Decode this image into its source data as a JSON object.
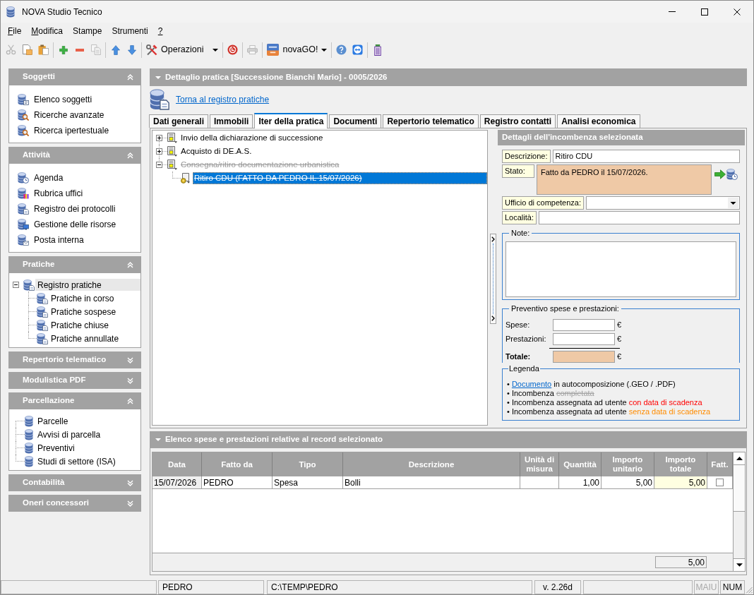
{
  "window": {
    "title": "NOVA Studio Tecnico"
  },
  "menu": [
    {
      "label": "File",
      "mnemonic": true
    },
    {
      "label": "Modifica",
      "mnemonic": true
    },
    {
      "label": "Stampe",
      "mnemonic": false
    },
    {
      "label": "Strumenti",
      "mnemonic": false
    },
    {
      "label": "?",
      "mnemonic": true
    }
  ],
  "toolbar": [
    {
      "kind": "button",
      "disabled": true
    },
    {
      "kind": "button",
      "disabled": false
    },
    {
      "kind": "button",
      "disabled": false
    },
    {
      "kind": "separator"
    },
    {
      "kind": "button",
      "disabled": false
    },
    {
      "kind": "button",
      "disabled": false
    },
    {
      "kind": "button",
      "disabled": true
    },
    {
      "kind": "separator"
    },
    {
      "kind": "button",
      "disabled": false
    },
    {
      "kind": "button",
      "disabled": false
    },
    {
      "kind": "separator"
    },
    {
      "kind": "menu_button",
      "label": "Operazioni"
    },
    {
      "kind": "separator"
    },
    {
      "kind": "button",
      "disabled": false
    },
    {
      "kind": "separator"
    },
    {
      "kind": "button",
      "disabled": true
    },
    {
      "kind": "separator"
    },
    {
      "kind": "menu_button",
      "label": "novaGO!"
    },
    {
      "kind": "separator"
    },
    {
      "kind": "button",
      "disabled": false
    },
    {
      "kind": "button",
      "disabled": false
    },
    {
      "kind": "separator"
    },
    {
      "kind": "button",
      "disabled": false
    }
  ],
  "sidebar": {
    "panels": [
      {
        "title": "Soggetti",
        "expanded": true,
        "kind": "list",
        "items": [
          {
            "label": "Elenco soggetti",
            "selected": false
          },
          {
            "label": "Ricerche avanzate",
            "selected": false
          },
          {
            "label": "Ricerca ipertestuale",
            "selected": false
          }
        ]
      },
      {
        "title": "Attività",
        "expanded": true,
        "kind": "list",
        "items": [
          {
            "label": "Agenda",
            "selected": false
          },
          {
            "label": "Rubrica uffici",
            "selected": false
          },
          {
            "label": "Registro dei protocolli",
            "selected": false
          },
          {
            "label": "Gestione delle risorse",
            "selected": false
          },
          {
            "label": "Posta interna",
            "selected": false
          }
        ]
      },
      {
        "title": "Pratiche",
        "expanded": true,
        "kind": "tree",
        "items": [
          {
            "label": "Registro pratiche",
            "selected": true,
            "expanded": true,
            "children": [
              {
                "label": "Pratiche in corso",
                "selected": false
              },
              {
                "label": "Pratiche sospese",
                "selected": false
              },
              {
                "label": "Pratiche chiuse",
                "selected": false
              },
              {
                "label": "Pratiche annullate",
                "selected": false
              }
            ]
          }
        ]
      },
      {
        "title": "Repertorio telematico",
        "expanded": false
      },
      {
        "title": "Modulistica PDF",
        "expanded": false
      },
      {
        "title": "Parcellazione",
        "expanded": true,
        "kind": "tree",
        "items": [
          {
            "label": "Parcelle",
            "selected": false
          },
          {
            "label": "Avvisi di parcella",
            "selected": false
          },
          {
            "label": "Preventivi",
            "selected": false
          },
          {
            "label": "Studi di settore (ISA)",
            "selected": false
          }
        ]
      },
      {
        "title": "Contabilità",
        "expanded": false
      },
      {
        "title": "Oneri concessori",
        "expanded": false
      }
    ]
  },
  "detail": {
    "title": "Dettaglio pratica [Successione Bianchi Mario] - 0005/2026",
    "back_link": "Torna al registro pratiche",
    "tabs": [
      {
        "label": "Dati generali",
        "selected": false
      },
      {
        "label": "Immobili",
        "selected": false
      },
      {
        "label": "Iter della pratica",
        "selected": true
      },
      {
        "label": "Documenti",
        "selected": false
      },
      {
        "label": "Repertorio telematico",
        "selected": false
      },
      {
        "label": "Registro contatti",
        "selected": false
      },
      {
        "label": "Analisi economica",
        "selected": false
      }
    ],
    "tree": [
      {
        "kind": "group",
        "label": "Invio della dichiarazione di successione",
        "expanded": false,
        "completed": false,
        "selected": false
      },
      {
        "kind": "group",
        "label": "Acquisto di DE.A.S.",
        "expanded": false,
        "completed": false,
        "selected": false
      },
      {
        "kind": "group",
        "label": "Consegna/ritiro documentazione urbanistica",
        "expanded": true,
        "completed": true,
        "selected": false,
        "children": [
          {
            "kind": "task",
            "label": "Ritiro CDU (FATTO DA PEDRO IL 15/07/2026)",
            "completed": true,
            "selected": true
          }
        ]
      }
    ],
    "panel": {
      "title": "Dettagli dell'incombenza selezionata",
      "fields": [
        {
          "kind": "text",
          "label": "Descrizione:",
          "value": "Ritiro CDU"
        },
        {
          "kind": "status",
          "label": "Stato:",
          "value": "Fatto da PEDRO il 15/07/2026."
        },
        {
          "kind": "select",
          "label": "Ufficio di competenza:"
        },
        {
          "kind": "text",
          "label": "Località:"
        }
      ],
      "notes": {
        "title": "Note:"
      },
      "estimate": {
        "title": "Preventivo spese e prestazioni:",
        "rows": [
          {
            "kind": "input",
            "label": "Spese:",
            "currency": "€"
          },
          {
            "kind": "input",
            "label": "Prestazioni:",
            "currency": "€"
          },
          {
            "kind": "total",
            "label": "Totale:",
            "currency": "€"
          }
        ]
      },
      "legend": {
        "title": "Legenda",
        "items": [
          {
            "parts": [
              {
                "kind": "plain",
                "text": "• "
              },
              {
                "kind": "link",
                "text": "Documento"
              },
              {
                "kind": "plain",
                "text": " in autocomposizione (.GEO / .PDF)"
              }
            ]
          },
          {
            "parts": [
              {
                "kind": "plain",
                "text": "• Incombenza "
              },
              {
                "kind": "completed",
                "text": "completata"
              }
            ]
          },
          {
            "parts": [
              {
                "kind": "plain",
                "text": "• Incombenza assegnata ad utente "
              },
              {
                "kind": "with_deadline",
                "text": "con data di scadenza"
              }
            ]
          },
          {
            "parts": [
              {
                "kind": "plain",
                "text": "• Incombenza assegnata ad utente "
              },
              {
                "kind": "without_deadline",
                "text": "senza data di scadenza"
              }
            ]
          }
        ]
      }
    }
  },
  "expenses": {
    "title": "Elenco spese e prestazioni relative al record selezionato",
    "columns": [
      "Data",
      "Fatto da",
      "Tipo",
      "Descrizione",
      "Unità di misura",
      "Quantità",
      "Importo unitario",
      "Importo totale",
      "Fatt."
    ],
    "rows": [
      {
        "data": "15/07/2026",
        "fatto_da": "PEDRO",
        "tipo": "Spesa",
        "descrizione": "Bolli",
        "quantita": "1,00",
        "importo_unitario": "5,00",
        "importo_totale": "5,00",
        "fatturato": false
      }
    ],
    "total": "5,00"
  },
  "status_bar": [
    {
      "text": "PEDRO",
      "disabled": false
    },
    {
      "text": "C:\\TEMP\\PEDRO",
      "disabled": false
    },
    {
      "text": "v. 2.26d",
      "disabled": false
    },
    {
      "text": "MAIU",
      "disabled": true
    },
    {
      "text": "NUM",
      "disabled": false
    }
  ]
}
